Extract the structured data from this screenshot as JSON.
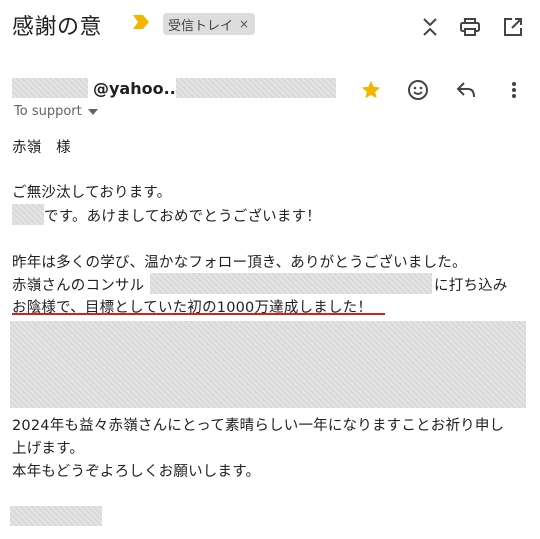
{
  "header": {
    "subject": "感謝の意",
    "label": "受信トレイ",
    "label_remove": "×"
  },
  "icons": {
    "importance": "importance-marker-icon",
    "expand": "expand-collapse-icon",
    "print": "print-icon",
    "open_new": "open-in-new-window-icon",
    "star": "star-icon",
    "emoji": "emoji-react-icon",
    "reply": "reply-icon",
    "more": "more-vert-icon",
    "dropdown": "dropdown-arrow-icon"
  },
  "colors": {
    "importance": "#f4b400",
    "star": "#f4b400",
    "highlight_underline": "#d81f1f"
  },
  "message": {
    "sender": "@yahoo....",
    "recipient": "To support",
    "greeting": "赤嶺　様",
    "line1": "ご無沙汰しております。",
    "line2": "です。あけましておめでとうございます！",
    "line3": "昨年は多くの学び、温かなフォロー頂き、ありがとうございました。",
    "line4a": "赤嶺さんのコンサル",
    "line4b": "に打ち込み",
    "line5": "お陰様で、目標としていた初の1000万達成しました！",
    "line6": "2024年も益々赤嶺さんにとって素晴らしい一年になりますことお祈り申し",
    "line7": "上げます。",
    "line8": "本年もどうぞよろしくお願いします。"
  }
}
